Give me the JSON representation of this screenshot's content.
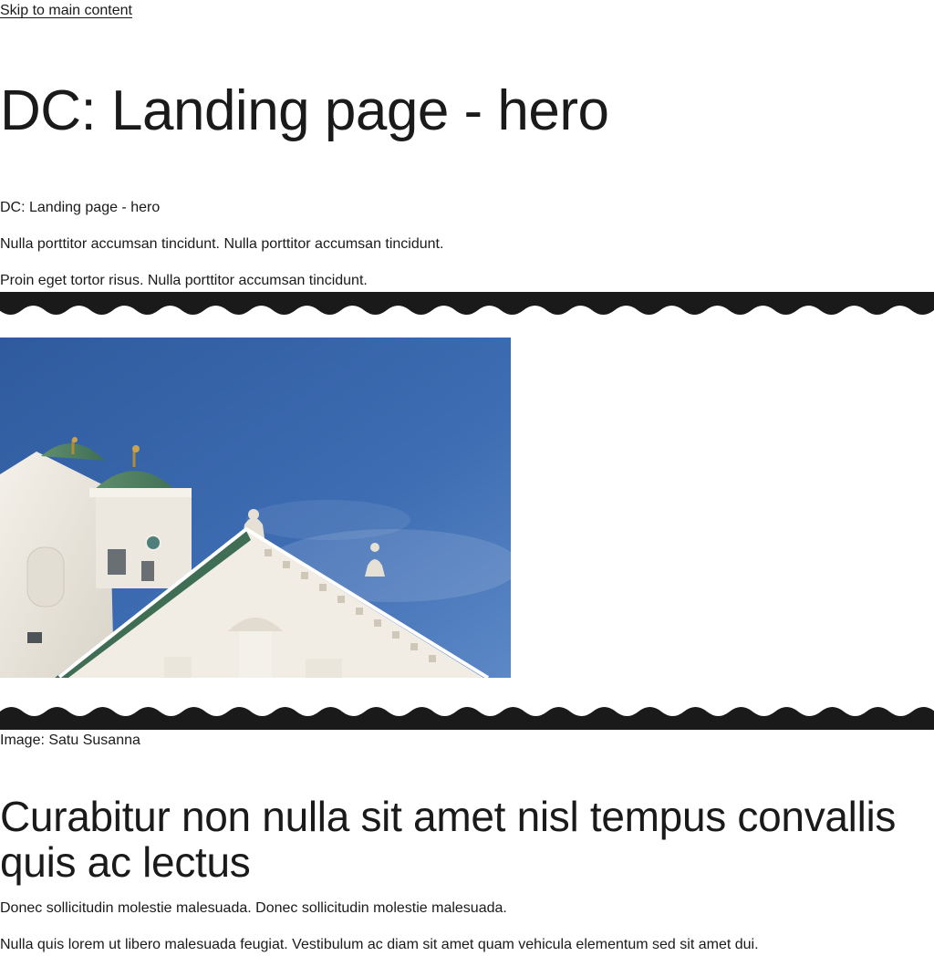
{
  "skip_link": "Skip to main content",
  "page_title": "DC: Landing page - hero",
  "intro": {
    "subtitle": "DC: Landing page - hero",
    "lines": [
      "Nulla porttitor accumsan tincidunt. Nulla porttitor accumsan tincidunt.",
      "Proin eget tortor risus. Nulla porttitor accumsan tincidunt."
    ]
  },
  "hero": {
    "image_alt": "Helsinki Cathedral against a blue sky",
    "credit": "Image: Satu Susanna"
  },
  "section": {
    "heading": "Curabitur non nulla sit amet nisl tempus convallis quis ac lectus",
    "paragraphs": [
      "Donec sollicitudin molestie malesuada. Donec sollicitudin molestie malesuada.",
      "Nulla quis lorem ut libero malesuada feugiat. Vestibulum ac diam sit amet quam vehicula elementum sed sit amet dui."
    ]
  },
  "colors": {
    "text": "#1a1a1a",
    "band": "#1a1a1a",
    "background": "#ffffff",
    "sky": "#3a64a8"
  }
}
